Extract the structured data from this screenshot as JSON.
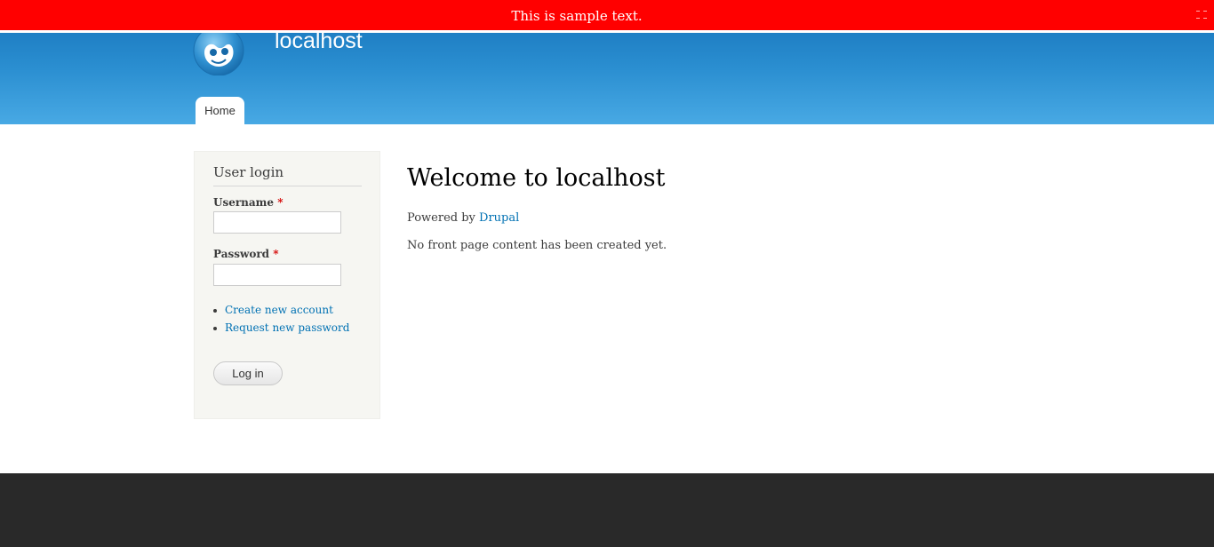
{
  "banner": {
    "text": "This is sample text."
  },
  "header": {
    "site_name": "localhost",
    "logo_icon": "drupal-drop-icon",
    "nav": [
      {
        "label": "Home",
        "active": true
      }
    ]
  },
  "login_block": {
    "title": "User login",
    "username_label": "Username",
    "password_label": "Password",
    "required_marker": "*",
    "username_value": "",
    "password_value": "",
    "links": [
      {
        "label": "Create new account"
      },
      {
        "label": "Request new password"
      }
    ],
    "submit_label": "Log in"
  },
  "main": {
    "title": "Welcome to localhost",
    "powered_prefix": "Powered by",
    "powered_link": "Drupal",
    "message": "No front page content has been created yet."
  },
  "colors": {
    "banner_bg": "#ff0000",
    "header_top": "#1f7fc4",
    "header_bottom": "#48a9e4",
    "link": "#0071b3",
    "footer_bg": "#292929"
  }
}
